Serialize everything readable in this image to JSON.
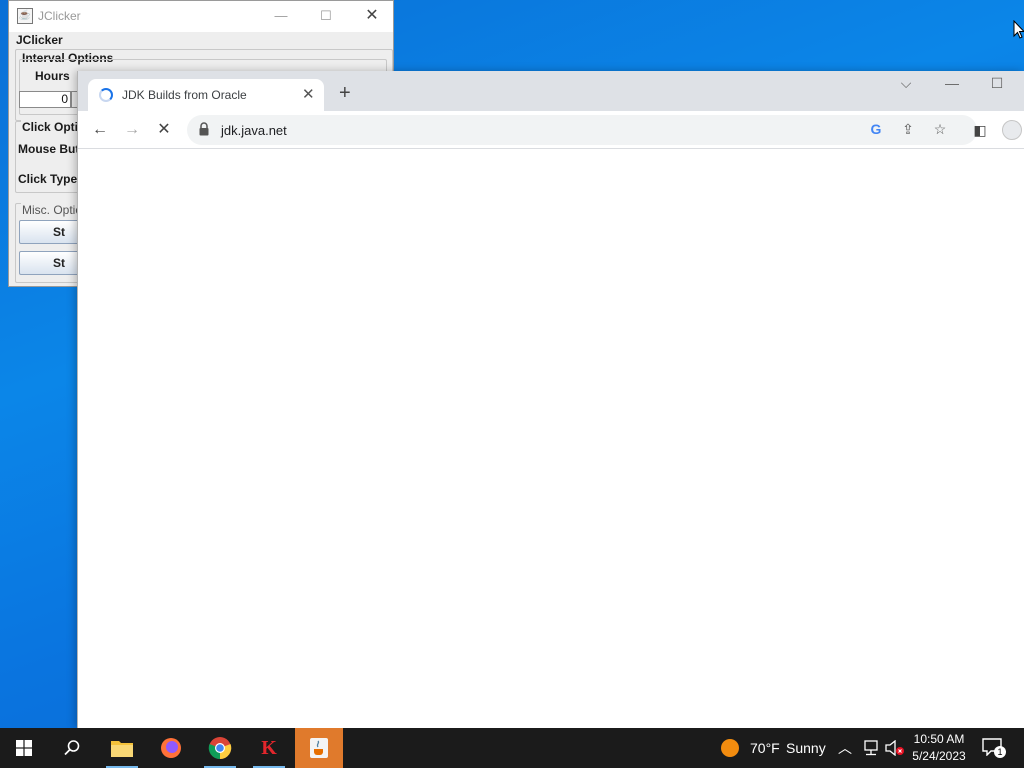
{
  "jclicker": {
    "title": "JClicker",
    "heading": "JClicker",
    "interval_group": "Interval Options",
    "hours_label": "Hours",
    "hours_value": "0",
    "click_group": "Click Optio",
    "mouse_button_label": "Mouse But",
    "click_type_label": "Click Type:",
    "misc_group": "Misc. Optio",
    "start_button": "St",
    "stop_button": "St"
  },
  "browser": {
    "tab_title": "JDK Builds from Oracle",
    "url": "jdk.java.net",
    "loading": true
  },
  "taskbar": {
    "weather_temp": "70°F",
    "weather_desc": "Sunny",
    "time": "10:50 AM",
    "date": "5/24/2023",
    "notification_count": "1",
    "apps": [
      "start",
      "search",
      "file-explorer",
      "firefox",
      "chrome",
      "kaspersky",
      "java"
    ]
  },
  "colors": {
    "desktop": "#0a74df",
    "taskbar": "#1b1b1b",
    "active_app": "#e07a2c",
    "chrome_tab_strip": "#dee1e6"
  }
}
